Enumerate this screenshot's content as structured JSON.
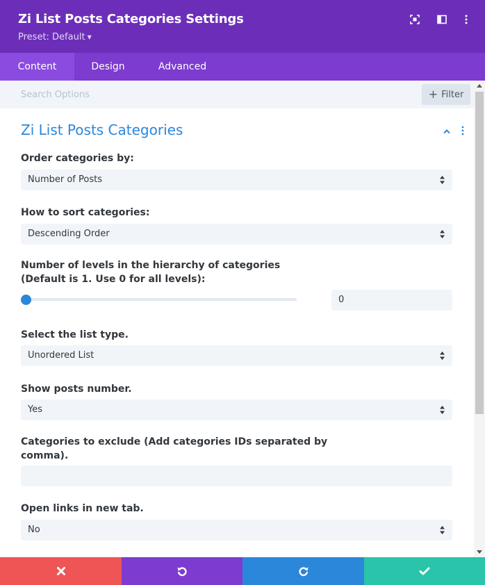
{
  "header": {
    "title": "Zi List Posts Categories Settings",
    "preset": "Preset: Default",
    "icons": [
      "expand-icon",
      "split-view-icon",
      "more-vertical-icon"
    ]
  },
  "tabs": [
    {
      "label": "Content",
      "active": true
    },
    {
      "label": "Design",
      "active": false
    },
    {
      "label": "Advanced",
      "active": false
    }
  ],
  "search": {
    "placeholder": "Search Options",
    "value": "",
    "filter_label": "Filter"
  },
  "section": {
    "title": "Zi List Posts Categories"
  },
  "fields": {
    "order_by": {
      "label": "Order categories by:",
      "value": "Number of Posts"
    },
    "sort": {
      "label": "How to sort categories:",
      "value": "Descending Order"
    },
    "levels": {
      "label_line1": "Number of levels in the hierarchy of categories",
      "label_line2": "(Default is 1. Use 0 for all levels):",
      "value": "0",
      "slider_fraction": 0
    },
    "list_type": {
      "label": "Select the list type.",
      "value": "Unordered List"
    },
    "show_number": {
      "label": "Show posts number.",
      "value": "Yes"
    },
    "exclude": {
      "label_line1": "Categories to exclude (Add categories IDs separated by",
      "label_line2": "comma).",
      "value": ""
    },
    "new_tab": {
      "label": "Open links in new tab.",
      "value": "No"
    }
  },
  "footer": {
    "colors": {
      "cancel": "#ef5555",
      "undo": "#7e3bd0",
      "redo": "#2b87da",
      "save": "#29c4a9"
    }
  },
  "colors": {
    "header": "#6c2eb9",
    "tabs": "#7d3bcf",
    "accent": "#2b87da"
  }
}
